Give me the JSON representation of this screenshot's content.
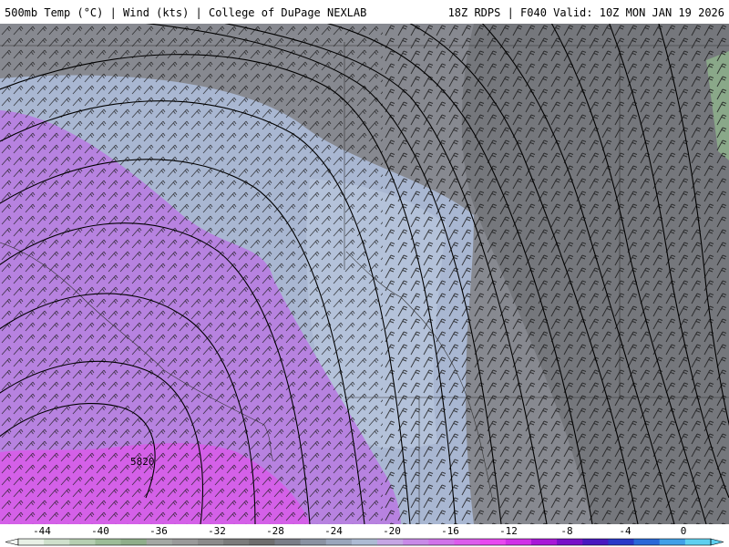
{
  "header": {
    "left_title": "500mb Temp (°C) | Wind (kts) | College of DuPage NEXLAB",
    "right_title": "18Z RDPS | F040 Valid: 10Z MON JAN 19 2026"
  },
  "map": {
    "contour_label": "5820",
    "region_colors": {
      "far_gray": "#6f7176",
      "mid_gray": "#8a8c93",
      "light_blue": "#a9b7d2",
      "pale_blue": "#b4c2da",
      "violet": "#b782e0",
      "magenta": "#d460e8",
      "green_edge": "#8aa889"
    }
  },
  "colorbar": {
    "tick_labels": [
      "-44",
      "-40",
      "-36",
      "-32",
      "-28",
      "-24",
      "-20",
      "-16",
      "-12",
      "-8",
      "-4",
      "0"
    ],
    "colors": [
      "#e8f0e6",
      "#cfe0cc",
      "#b6cfb2",
      "#9dbd98",
      "#8fae8a",
      "#a4a8a4",
      "#9a9a9a",
      "#8b8b8b",
      "#7c7c7c",
      "#6e6e6e",
      "#7a7e88",
      "#8a92a2",
      "#9aa6bc",
      "#adbbd4",
      "#c5a6e4",
      "#c88ae8",
      "#d073ea",
      "#dc5cec",
      "#e848f0",
      "#d030e8",
      "#a818d8",
      "#7810c8",
      "#4818c0",
      "#2838c8",
      "#2868d8",
      "#40a0e8",
      "#5ed0f0"
    ]
  }
}
